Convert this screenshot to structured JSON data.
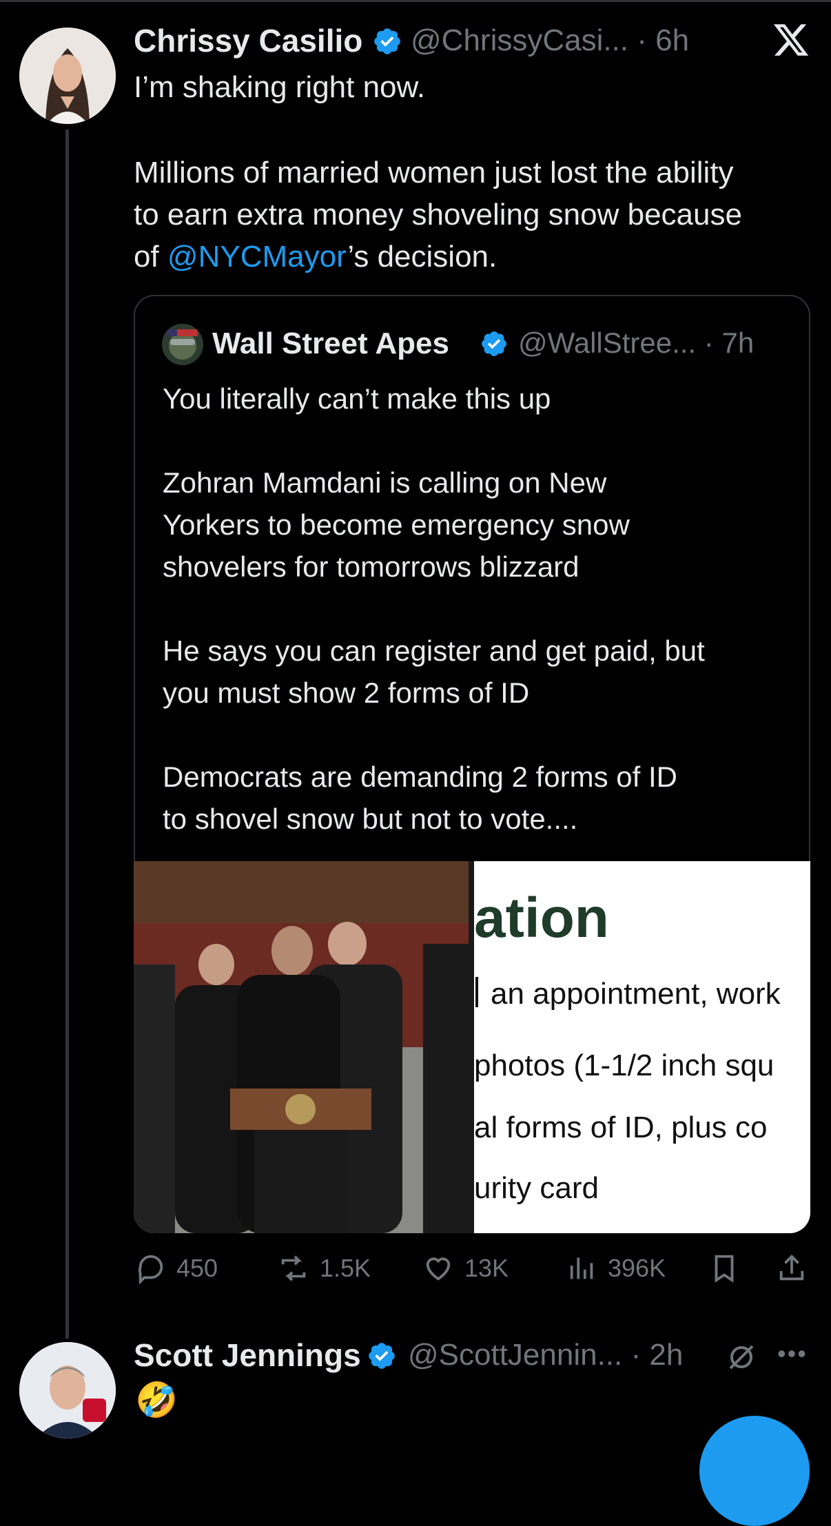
{
  "tweet1": {
    "name": "Chrissy Casilio",
    "handle_time": "@ChrissyCasi... · 6h",
    "line1": "I’m shaking right now.",
    "para_before": "Millions of married women just lost the ability\nto earn extra money shoveling snow because\nof ",
    "mention": "@NYCMayor",
    "para_after": "’s decision.",
    "close_icon": "x-logo-icon"
  },
  "quote": {
    "name": "Wall Street Apes",
    "handle_time": "@WallStree... · 7h",
    "text": "You literally can’t make this up\n\nZohran Mamdani is calling on New\nYorkers to become emergency snow\nshovelers for tomorrows blizzard\n\nHe says you can register and get paid, but\nyou must show 2 forms of ID\n\nDemocrats are demanding 2 forms of ID\nto shovel snow but not to vote....",
    "doc_heading": "ation",
    "doc_lines": [
      "an appointment, work",
      "photos (1-1/2 inch squ",
      "al forms of ID, plus co",
      "urity card"
    ]
  },
  "actions": {
    "replies": "450",
    "reposts": "1.5K",
    "likes": "13K",
    "views": "396K"
  },
  "tweet2": {
    "name": "Scott Jennings",
    "handle_time": "@ScottJennin... · 2h",
    "text": "🤣"
  },
  "colors": {
    "background": "#000000",
    "accent": "#1d9bf0",
    "muted": "#71767b",
    "text": "#e7e9ea"
  }
}
